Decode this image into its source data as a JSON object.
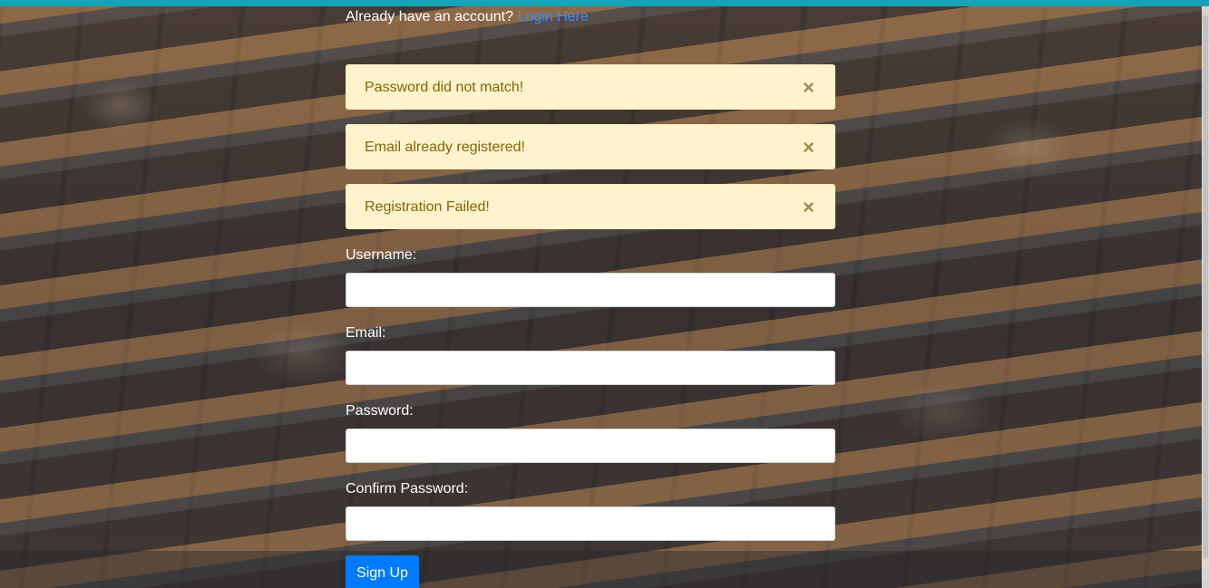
{
  "header": {
    "accent_color": "#17a2b8"
  },
  "login_prompt": {
    "text": "Already have an account?",
    "link_label": "Login Here"
  },
  "alerts": [
    {
      "message": "Password did not match!",
      "close_label": "×"
    },
    {
      "message": "Email already registered!",
      "close_label": "×"
    },
    {
      "message": "Registration Failed!",
      "close_label": "×"
    }
  ],
  "form": {
    "username": {
      "label": "Username:",
      "value": ""
    },
    "email": {
      "label": "Email:",
      "value": ""
    },
    "password": {
      "label": "Password:",
      "value": ""
    },
    "confirm_password": {
      "label": "Confirm Password:",
      "value": ""
    },
    "submit_label": "Sign Up"
  },
  "colors": {
    "alert_bg": "#fff3cd",
    "alert_text": "#856404",
    "primary_button": "#007bff",
    "link": "#3b8cff"
  }
}
